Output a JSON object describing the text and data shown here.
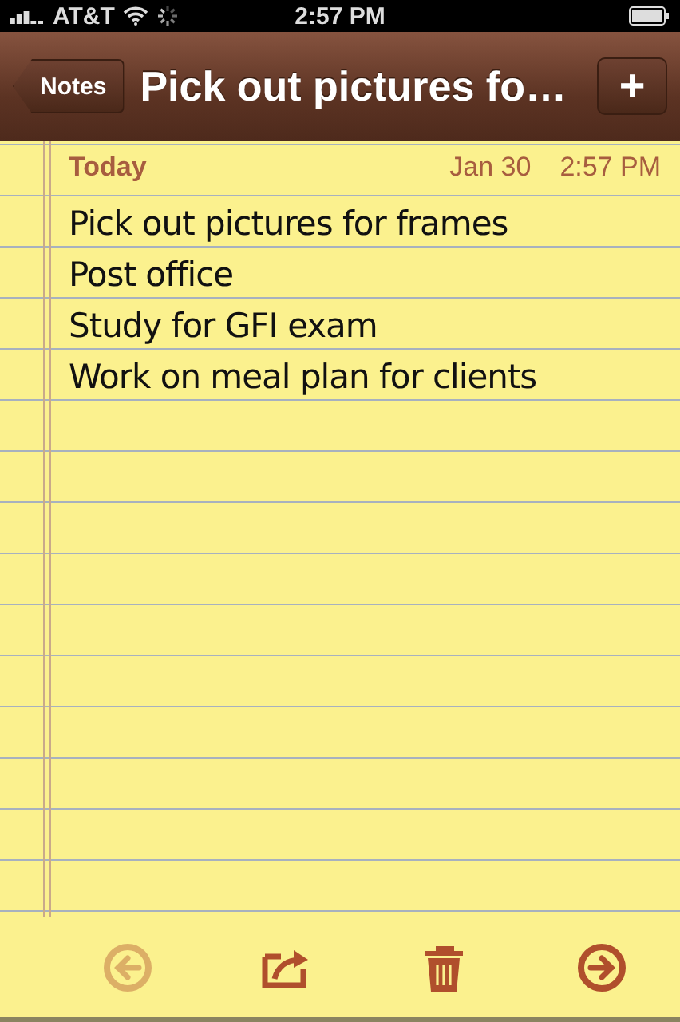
{
  "status_bar": {
    "carrier": "AT&T",
    "time": "2:57 PM"
  },
  "nav_bar": {
    "back_button": "Notes",
    "title": "Pick out pictures fo…",
    "add_button": "+"
  },
  "note": {
    "day": "Today",
    "date": "Jan 30",
    "time": "2:57 PM",
    "lines": [
      "Pick out pictures for frames",
      "Post office",
      "Study for GFI exam",
      "Work on meal plan for clients"
    ]
  },
  "toolbar": [
    {
      "kind": "previous",
      "disabled": true
    },
    {
      "kind": "share",
      "disabled": false
    },
    {
      "kind": "trash",
      "disabled": false
    },
    {
      "kind": "next",
      "disabled": false
    }
  ]
}
